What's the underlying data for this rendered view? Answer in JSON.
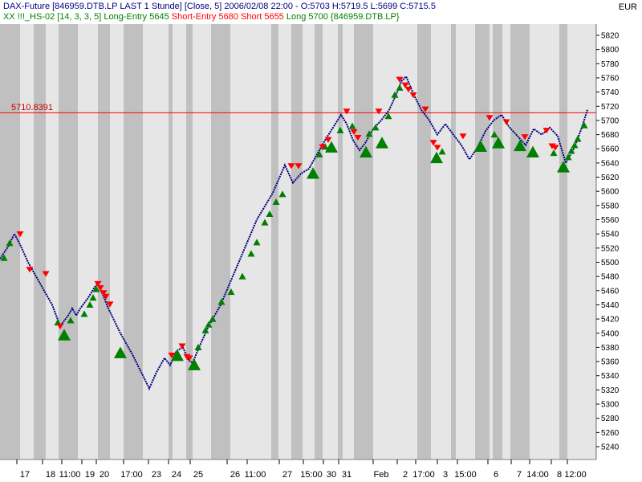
{
  "header": {
    "instrument": "DAX-Future [846959.DTB.LP LAST 1 Stunde] [Close, 5] 2006/02/08 22:00 - O:5703 H:5719.5 L:5699 C:5715.5",
    "strategy_prefix": "XX !!!_HS-02 [14, 3, 3, 5]",
    "long_entry": "Long-Entry 5645",
    "short_entry": "Short-Entry 5680",
    "short": "Short 5655",
    "long_suffix": "Long 5700 {846959.DTB.LP}",
    "currency": "EUR"
  },
  "colors": {
    "background": "#ffffff",
    "band_gray": "#c0c0c0",
    "band_light": "#e6e6e6",
    "price_line": "#000080",
    "long_marker": "#008000",
    "short_marker": "#ff0000",
    "ref_line": "#ff0000",
    "strategy_text": "#008000",
    "short_text": "#ff0000"
  },
  "chart_data": {
    "type": "line",
    "title": "DAX-Future [846959.DTB.LP LAST 1 Stunde] [Close, 5]",
    "ylim": [
      5225,
      5835
    ],
    "y_ticks": [
      5240,
      5260,
      5280,
      5300,
      5320,
      5340,
      5360,
      5380,
      5400,
      5420,
      5440,
      5460,
      5480,
      5500,
      5520,
      5540,
      5560,
      5580,
      5600,
      5620,
      5640,
      5660,
      5680,
      5700,
      5720,
      5740,
      5760,
      5780,
      5800,
      5820
    ],
    "reference_line": {
      "value": 5710.8391,
      "label": "5710.8391"
    },
    "x_range": [
      0,
      743
    ],
    "x_tick_labels": [
      "17",
      "18",
      "11:00",
      "19",
      "20",
      "17:00",
      "23",
      "24",
      "25",
      "26",
      "11:00",
      "27",
      "15:00",
      "30",
      "31",
      "Feb",
      "2",
      "17:00",
      "3",
      "15:00",
      "6",
      "7",
      "14:00",
      "8",
      "12:00"
    ],
    "x_tick_positions": [
      31,
      63,
      87,
      112,
      130,
      164,
      195,
      220,
      247,
      293,
      318,
      358,
      388,
      413,
      432,
      475,
      505,
      528,
      555,
      580,
      618,
      647,
      670,
      697,
      717
    ],
    "gray_bands": [
      [
        0,
        25
      ],
      [
        42,
        57
      ],
      [
        73,
        97
      ],
      [
        122,
        137
      ],
      [
        154,
        178
      ],
      [
        210,
        215
      ],
      [
        232,
        240
      ],
      [
        263,
        287
      ],
      [
        338,
        347
      ],
      [
        363,
        377
      ],
      [
        392,
        402
      ],
      [
        421,
        427
      ],
      [
        441,
        465
      ],
      [
        520,
        537
      ],
      [
        562,
        568
      ],
      [
        592,
        610
      ],
      [
        614,
        626
      ],
      [
        636,
        660
      ],
      [
        697,
        707
      ],
      [
        742,
        790
      ]
    ],
    "series": [
      {
        "x": [
          0,
          10,
          18,
          25,
          35,
          50,
          65,
          75,
          85,
          90,
          95,
          100,
          110,
          118,
          122,
          128,
          135,
          150,
          165,
          176,
          186,
          195,
          205,
          212,
          220,
          228,
          235,
          240,
          248,
          260,
          275,
          290,
          305,
          320,
          340,
          355,
          365,
          375,
          385,
          395,
          405,
          415,
          425,
          432,
          440,
          448,
          455,
          465,
          475,
          485,
          495,
          500,
          506,
          515,
          525,
          535,
          545,
          555,
          565,
          575,
          585,
          595,
          605,
          615,
          625,
          635,
          645,
          655,
          665,
          675,
          685,
          695,
          705,
          715,
          725,
          732
        ],
        "values": [
          5505,
          5522,
          5540,
          5525,
          5500,
          5470,
          5440,
          5410,
          5425,
          5435,
          5425,
          5435,
          5450,
          5465,
          5470,
          5455,
          5435,
          5400,
          5370,
          5345,
          5322,
          5345,
          5365,
          5355,
          5375,
          5380,
          5362,
          5358,
          5380,
          5410,
          5440,
          5480,
          5520,
          5560,
          5598,
          5637,
          5612,
          5625,
          5632,
          5652,
          5672,
          5690,
          5708,
          5695,
          5672,
          5658,
          5668,
          5688,
          5700,
          5715,
          5740,
          5755,
          5762,
          5738,
          5715,
          5700,
          5680,
          5695,
          5680,
          5665,
          5645,
          5662,
          5685,
          5700,
          5708,
          5690,
          5678,
          5665,
          5688,
          5680,
          5690,
          5678,
          5640,
          5660,
          5690,
          5715
        ]
      }
    ],
    "long_markers": {
      "big": [
        [
          80,
          5397
        ],
        [
          150,
          5372
        ],
        [
          221,
          5368
        ],
        [
          242,
          5355
        ],
        [
          390,
          5625
        ],
        [
          413,
          5662
        ],
        [
          456,
          5655
        ],
        [
          476,
          5668
        ],
        [
          544,
          5647
        ],
        [
          599,
          5663
        ],
        [
          621,
          5668
        ],
        [
          648,
          5664
        ],
        [
          664,
          5655
        ],
        [
          702,
          5634
        ]
      ],
      "small": [
        [
          5,
          5506
        ],
        [
          12,
          5527
        ],
        [
          72,
          5415
        ],
        [
          88,
          5418
        ],
        [
          105,
          5427
        ],
        [
          112,
          5440
        ],
        [
          116,
          5450
        ],
        [
          120,
          5462
        ],
        [
          247,
          5380
        ],
        [
          256,
          5404
        ],
        [
          260,
          5412
        ],
        [
          265,
          5420
        ],
        [
          276,
          5444
        ],
        [
          288,
          5458
        ],
        [
          302,
          5480
        ],
        [
          313,
          5512
        ],
        [
          320,
          5528
        ],
        [
          330,
          5556
        ],
        [
          336,
          5568
        ],
        [
          344,
          5585
        ],
        [
          352,
          5596
        ],
        [
          398,
          5652
        ],
        [
          405,
          5663
        ],
        [
          424,
          5686
        ],
        [
          439,
          5692
        ],
        [
          460,
          5681
        ],
        [
          468,
          5690
        ],
        [
          484,
          5706
        ],
        [
          492,
          5736
        ],
        [
          498,
          5746
        ],
        [
          551,
          5656
        ],
        [
          616,
          5680
        ],
        [
          690,
          5654
        ],
        [
          708,
          5648
        ],
        [
          712,
          5657
        ],
        [
          716,
          5665
        ],
        [
          720,
          5674
        ],
        [
          728,
          5693
        ]
      ]
    },
    "short_markers": [
      [
        25,
        5540
      ],
      [
        37,
        5490
      ],
      [
        57,
        5484
      ],
      [
        75,
        5410
      ],
      [
        122,
        5470
      ],
      [
        125,
        5464
      ],
      [
        129,
        5457
      ],
      [
        132,
        5452
      ],
      [
        137,
        5441
      ],
      [
        214,
        5369
      ],
      [
        227,
        5382
      ],
      [
        233,
        5367
      ],
      [
        236,
        5365
      ],
      [
        363,
        5636
      ],
      [
        372,
        5636
      ],
      [
        402,
        5663
      ],
      [
        409,
        5673
      ],
      [
        432,
        5713
      ],
      [
        441,
        5684
      ],
      [
        446,
        5676
      ],
      [
        472,
        5713
      ],
      [
        498,
        5758
      ],
      [
        505,
        5750
      ],
      [
        509,
        5744
      ],
      [
        515,
        5736
      ],
      [
        530,
        5716
      ],
      [
        540,
        5669
      ],
      [
        545,
        5662
      ],
      [
        577,
        5678
      ],
      [
        610,
        5704
      ],
      [
        631,
        5698
      ],
      [
        654,
        5677
      ],
      [
        681,
        5686
      ],
      [
        688,
        5664
      ],
      [
        692,
        5662
      ]
    ]
  }
}
